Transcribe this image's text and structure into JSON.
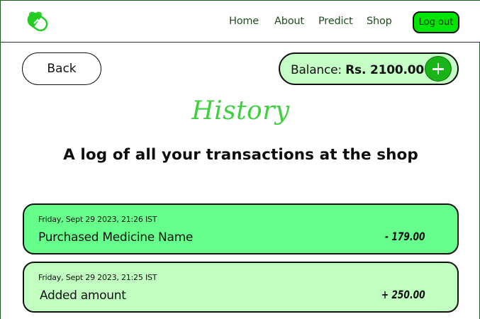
{
  "nav": {
    "links": [
      "Home",
      "About",
      "Predict",
      "Shop"
    ],
    "logout_label": "Log out"
  },
  "back_label": "Back",
  "balance": {
    "label": "Balance:",
    "amount": "Rs. 2100.00"
  },
  "history": {
    "title": "History",
    "subtitle": "A log of all your transactions at the shop"
  },
  "transactions": [
    {
      "date": "Friday, Sept 29 2023, 21:26 IST",
      "description": "Purchased Medicine Name",
      "amount": "- 179.00",
      "color": "#66ff8c"
    },
    {
      "date": "Friday, Sept 29 2023, 21:25 IST",
      "description": "Added amount",
      "amount": "+ 250.00",
      "color": "#c0ffc0"
    }
  ],
  "colors": {
    "accent": "#00e600",
    "title_green": "#3fcf3f",
    "balance_bg": "#c5ffc5",
    "add_button": "#18b418"
  },
  "icons": {
    "logo": "capsule-heart-logo",
    "add": "plus-icon"
  }
}
